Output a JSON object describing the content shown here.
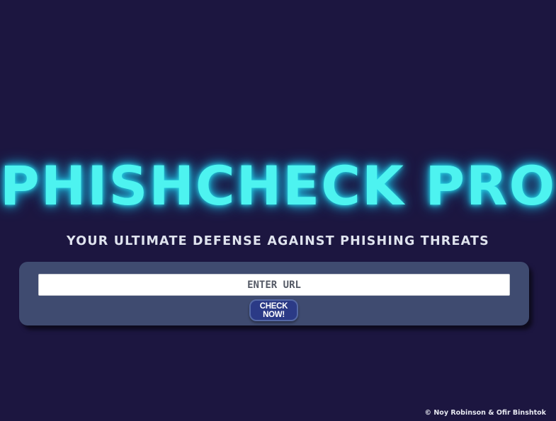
{
  "header": {
    "title": "PHISHCHECK PRO",
    "subtitle": "YOUR ULTIMATE DEFENSE AGAINST PHISHING THREATS"
  },
  "form": {
    "url_placeholder": "ENTER URL",
    "url_value": "",
    "submit_label": "CHECK NOW!"
  },
  "footer": {
    "copyright": "© Noy Robinson & Ofir Binshtok"
  },
  "colors": {
    "background": "#1c1640",
    "title": "#4df3f0",
    "card": "#3f4b70",
    "button": "#2b3a86"
  }
}
